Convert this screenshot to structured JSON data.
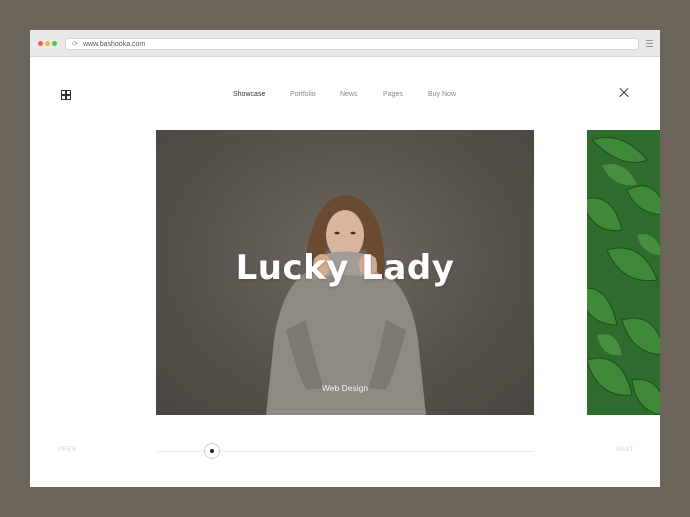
{
  "browser": {
    "url": "www.bashooka.com"
  },
  "nav": {
    "items": [
      {
        "label": "Showcase",
        "active": true
      },
      {
        "label": "Portfolio",
        "active": false
      },
      {
        "label": "News",
        "active": false
      },
      {
        "label": "Pages",
        "active": false
      },
      {
        "label": "Buy Now",
        "active": false
      }
    ]
  },
  "hero": {
    "title": "Lucky Lady",
    "subtitle": "Web Design"
  },
  "pager": {
    "prev_label": "PREV",
    "next_label": "NEXT"
  },
  "icons": {
    "menu": "grid-icon",
    "close": "close-icon",
    "reload": "reload-icon",
    "browser_menu": "hamburger-icon"
  },
  "colors": {
    "background": "#6b6458",
    "hero": "#58524c",
    "leaf_panel": "#2f6b2c",
    "traffic_red": "#f05b53",
    "traffic_yellow": "#f3b73f",
    "traffic_green": "#57c14a"
  }
}
